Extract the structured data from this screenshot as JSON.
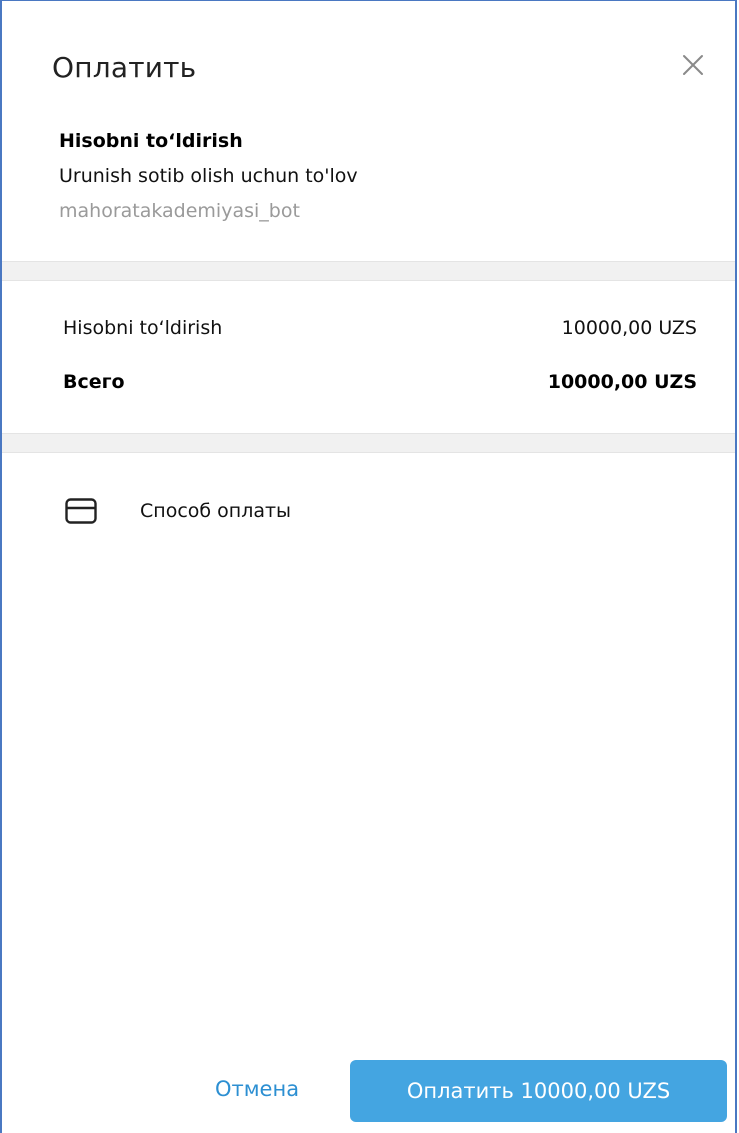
{
  "dialog": {
    "title": "Оплатить",
    "close_icon": "close-icon"
  },
  "invoice": {
    "title": "Hisobni to‘ldirish",
    "description": "Urunish sotib olish uchun to'lov",
    "bot_name": "mahoratakademiyasi_bot"
  },
  "prices": {
    "items": [
      {
        "label": "Hisobni to‘ldirish",
        "amount": "10000,00 UZS"
      }
    ],
    "total_label": "Всего",
    "total_amount": "10000,00 UZS"
  },
  "payment_method": {
    "icon": "card-icon",
    "label": "Способ оплаты"
  },
  "footer": {
    "cancel_label": "Отмена",
    "pay_label": "Оплатить 10000,00 UZS"
  },
  "colors": {
    "accent": "#44a5e1",
    "cancel_text": "#2c8fd2",
    "muted_text": "#9a9a9a",
    "separator": "#f1f1f1",
    "window_border": "#4a78c2"
  }
}
